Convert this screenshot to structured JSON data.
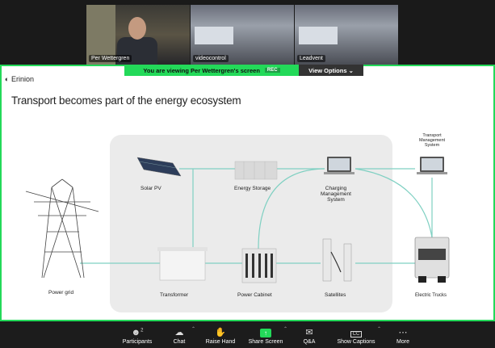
{
  "participants_strip": [
    {
      "name": "Per Wettergren"
    },
    {
      "name": "videocontrol"
    },
    {
      "name": "Leadvent"
    }
  ],
  "share_banner": {
    "text": "You are viewing Per Wettergren's screen",
    "rec": "REC",
    "view_options": "View Options"
  },
  "slide": {
    "logo": "Erinion",
    "title": "Transport becomes part of the energy ecosystem",
    "labels": {
      "solar_pv": "Solar PV",
      "energy_storage": "Energy Storage",
      "cms": "Charging Management System",
      "tms": "Transport Management System",
      "power_grid": "Power grid",
      "transformer": "Transformer",
      "power_cabinet": "Power Cabinet",
      "satellites": "Satellites",
      "electric_trucks": "Electric Trucks"
    }
  },
  "toolbar": {
    "participants": "Participants",
    "participants_count": "2",
    "chat": "Chat",
    "raise_hand": "Raise Hand",
    "share_screen": "Share Screen",
    "qa": "Q&A",
    "show_captions": "Show Captions",
    "more": "More"
  }
}
